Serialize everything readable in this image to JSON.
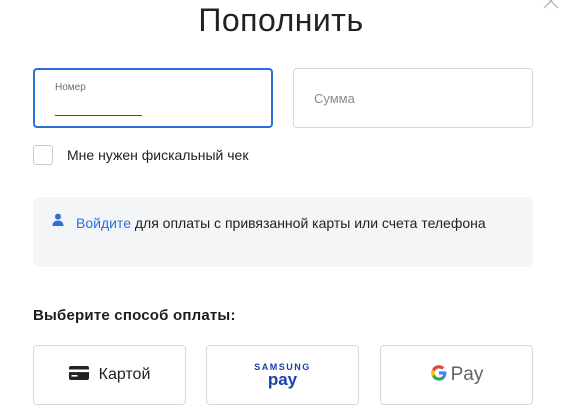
{
  "dialog": {
    "title": "Пополнить",
    "close_icon": "close-icon"
  },
  "form": {
    "phone": {
      "label": "Номер",
      "value": "___________"
    },
    "amount": {
      "placeholder": "Сумма"
    },
    "fiscal_check": {
      "label": "Мне нужен фискальный чек",
      "checked": false
    }
  },
  "info": {
    "icon": "user-icon",
    "link_text": "Войдите",
    "text": " для оплаты с привязанной карты или счета телефона"
  },
  "payment": {
    "section_title": "Выберите способ оплаты:",
    "card": {
      "label": "Картой",
      "icon": "credit-card-icon"
    },
    "samsung_pay": {
      "line1": "SAMSUNG",
      "line2": "pay"
    },
    "google_pay": {
      "label": "Pay",
      "icon": "google-g-icon"
    }
  },
  "colors": {
    "accent": "#2a6fdb",
    "border": "#d8d8d8",
    "info_bg": "#f4f5f7",
    "samsung_blue": "#1a3fae"
  }
}
